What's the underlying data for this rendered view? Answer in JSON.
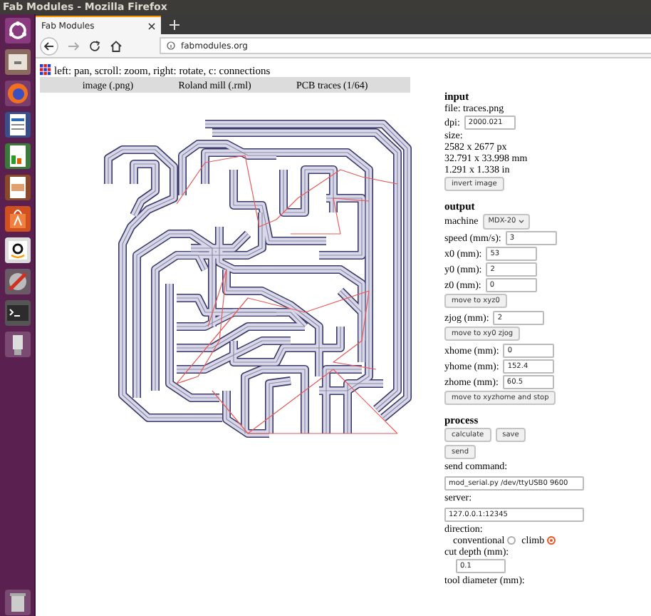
{
  "window": {
    "title": "Fab Modules - Mozilla Firefox"
  },
  "tabs": [
    {
      "label": "Fab Modules",
      "selected": true
    }
  ],
  "address_bar": {
    "url": "fabmodules.org"
  },
  "hint": "left: pan, scroll: zoom, right: rotate, c: connections",
  "module_bar": [
    "image (.png)",
    "Roland mill (.rml)",
    "PCB traces (1/64)"
  ],
  "sections": [
    {
      "heading": "input",
      "items": [
        {
          "kind": "text",
          "text": "file: traces.png"
        },
        {
          "kind": "field",
          "label": "dpi:",
          "value": "2000.021"
        },
        {
          "kind": "text",
          "text": "size:"
        },
        {
          "kind": "text",
          "text": "2582 x 2677 px"
        },
        {
          "kind": "text",
          "text": "32.791 x 33.998 mm"
        },
        {
          "kind": "text",
          "text": "1.291 x 1.338 in"
        },
        {
          "kind": "buttons",
          "buttons": [
            "invert image"
          ]
        }
      ]
    },
    {
      "heading": "output",
      "items": [
        {
          "kind": "select",
          "label": "machine",
          "value": "MDX-20"
        },
        {
          "kind": "field",
          "label": "speed (mm/s):",
          "value": "3"
        },
        {
          "kind": "field",
          "label": "x0 (mm):",
          "value": "53"
        },
        {
          "kind": "field",
          "label": "y0 (mm):",
          "value": "2"
        },
        {
          "kind": "field",
          "label": "z0 (mm):",
          "value": "0"
        },
        {
          "kind": "buttons",
          "buttons": [
            "move to xyz0"
          ]
        },
        {
          "kind": "field",
          "label": "zjog (mm):",
          "value": "2"
        },
        {
          "kind": "buttons",
          "buttons": [
            "move to xy0 zjog"
          ]
        },
        {
          "kind": "field",
          "label": "xhome (mm):",
          "value": "0"
        },
        {
          "kind": "field",
          "label": "yhome (mm):",
          "value": "152.4"
        },
        {
          "kind": "field",
          "label": "zhome (mm):",
          "value": "60.5"
        },
        {
          "kind": "buttons",
          "buttons": [
            "move to xyzhome and stop"
          ]
        }
      ]
    },
    {
      "heading": "process",
      "items": [
        {
          "kind": "buttons",
          "buttons": [
            "calculate",
            "save"
          ]
        },
        {
          "kind": "buttons",
          "buttons": [
            "send"
          ]
        },
        {
          "kind": "text",
          "text": "send command:"
        },
        {
          "kind": "wide_field",
          "value": "mod_serial.py /dev/ttyUSB0 9600"
        },
        {
          "kind": "text",
          "text": "server:"
        },
        {
          "kind": "wide_field",
          "value": "127.0.0.1:12345"
        },
        {
          "kind": "text",
          "text": "direction:"
        },
        {
          "kind": "radios",
          "options": [
            {
              "label": "conventional",
              "selected": false
            },
            {
              "label": "climb",
              "selected": true
            }
          ]
        },
        {
          "kind": "text",
          "text": "cut depth (mm):"
        },
        {
          "kind": "short_field",
          "value": "0.1"
        },
        {
          "kind": "text",
          "text": "tool diameter (mm):"
        }
      ]
    }
  ]
}
